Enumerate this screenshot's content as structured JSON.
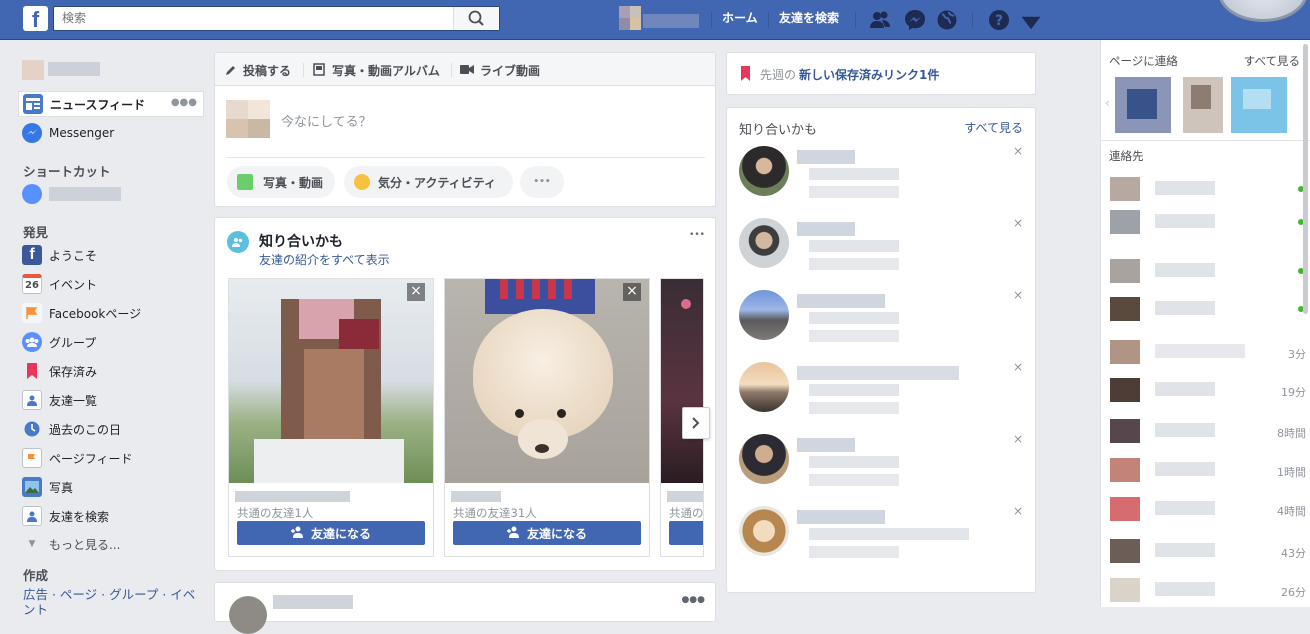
{
  "topbar": {
    "logo": "f",
    "search_placeholder": "検索",
    "home": "ホーム",
    "find_friends": "友達を検索"
  },
  "leftnav": {
    "news_feed": "ニュースフィード",
    "messenger": "Messenger",
    "shortcuts_title": "ショートカット",
    "explore_title": "発見",
    "items": [
      {
        "label": "ようこそ",
        "icon": "facebook-icon"
      },
      {
        "label": "イベント",
        "icon": "calendar-icon",
        "badge": "26"
      },
      {
        "label": "Facebookページ",
        "icon": "flag-icon"
      },
      {
        "label": "グループ",
        "icon": "groups-icon"
      },
      {
        "label": "保存済み",
        "icon": "bookmark-icon"
      },
      {
        "label": "友達一覧",
        "icon": "friends-list-icon"
      },
      {
        "label": "過去のこの日",
        "icon": "history-icon"
      },
      {
        "label": "ページフィード",
        "icon": "page-feed-icon"
      },
      {
        "label": "写真",
        "icon": "photo-icon"
      },
      {
        "label": "友達を検索",
        "icon": "find-friends-icon"
      }
    ],
    "see_more": "もっと見る...",
    "create_title": "作成",
    "create_links": "広告 · ページ · グループ · イベ",
    "create_more": "ント"
  },
  "composer": {
    "tab_post": "投稿する",
    "tab_album": "写真・動画アルバム",
    "tab_live": "ライブ動画",
    "placeholder": "今なにしてる？",
    "photo_video": "写真・動画",
    "feeling": "気分・アクティビティ",
    "more": "•••"
  },
  "pymk_card": {
    "title": "知り合いかも",
    "link": "友達の紹介をすべて表示",
    "more": "•••",
    "cards": [
      {
        "mutual": "共通の友達1人",
        "button": "友達になる"
      },
      {
        "mutual": "共通の友達31人",
        "button": "友達になる"
      },
      {
        "mutual": "共通の",
        "button": ""
      }
    ]
  },
  "saved_card": {
    "prefix": "先週の",
    "bold": "新しい保存済みリンク1件"
  },
  "right_pymk": {
    "title": "知り合いかも",
    "see_all": "すべて見る",
    "close": "×"
  },
  "chat": {
    "pages_title": "ページに連絡",
    "see_all": "すべて見る",
    "contacts_title": "連絡先",
    "times": [
      "",
      "",
      "",
      "",
      "3分",
      "19分",
      "8時間",
      "1時間",
      "4時間",
      "43分",
      "26分"
    ]
  },
  "colors": {
    "brand_blue": "#4267b2",
    "online_green": "#42b72a"
  }
}
